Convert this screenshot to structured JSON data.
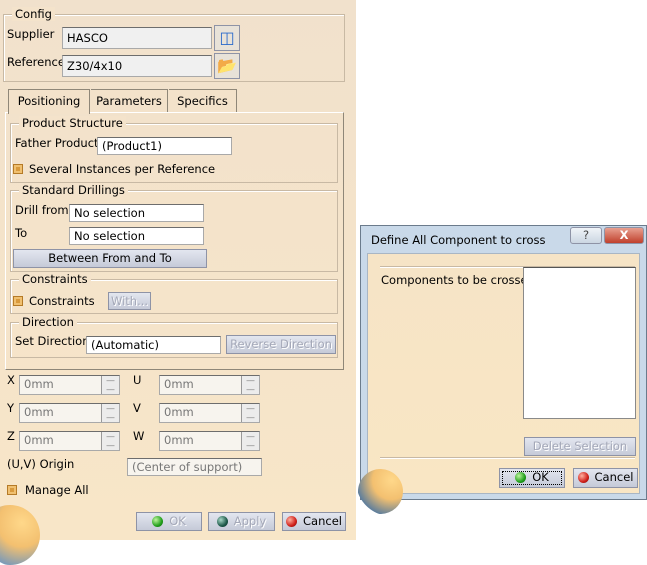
{
  "main": {
    "config": {
      "legend": "Config",
      "supplier_label": "Supplier",
      "supplier_value": "HASCO",
      "supplier_icon": "book-icon",
      "reference_label": "Reference",
      "reference_value": "Z30/4x10",
      "reference_icon": "open-folder-icon"
    },
    "tabs": [
      {
        "label": "Positioning",
        "active": true
      },
      {
        "label": "Parameters"
      },
      {
        "label": "Specifics"
      }
    ],
    "product_structure": {
      "legend": "Product Structure",
      "father_label": "Father Product",
      "father_value": "(Product1)",
      "several_instances": "Several Instances per Reference"
    },
    "drillings": {
      "legend": "Standard Drillings",
      "from_label": "Drill from",
      "from_value": "No selection",
      "to_label": "To",
      "to_value": "No selection",
      "between_button": "Between From and To"
    },
    "constraints": {
      "legend": "Constraints",
      "checkbox": "Constraints",
      "with_button": "With..."
    },
    "direction": {
      "legend": "Direction",
      "label": "Set Direction",
      "value": "(Automatic)",
      "reverse_button": "Reverse Direction"
    },
    "coords": [
      {
        "label": "X",
        "value": "0mm"
      },
      {
        "label": "Y",
        "value": "0mm"
      },
      {
        "label": "Z",
        "value": "0mm"
      },
      {
        "label": "U",
        "value": "0mm"
      },
      {
        "label": "V",
        "value": "0mm"
      },
      {
        "label": "W",
        "value": "0mm"
      }
    ],
    "origin": {
      "label": "(U,V) Origin",
      "value": "(Center of support)"
    },
    "manage_all": "Manage All",
    "buttons": {
      "ok": "OK",
      "apply": "Apply",
      "cancel": "Cancel"
    }
  },
  "dialog": {
    "title": "Define All Component to cross",
    "help": "?",
    "close": "X",
    "components_label": "Components to be crossed",
    "delete_button": "Delete Selection",
    "ok": "OK",
    "cancel": "Cancel"
  }
}
